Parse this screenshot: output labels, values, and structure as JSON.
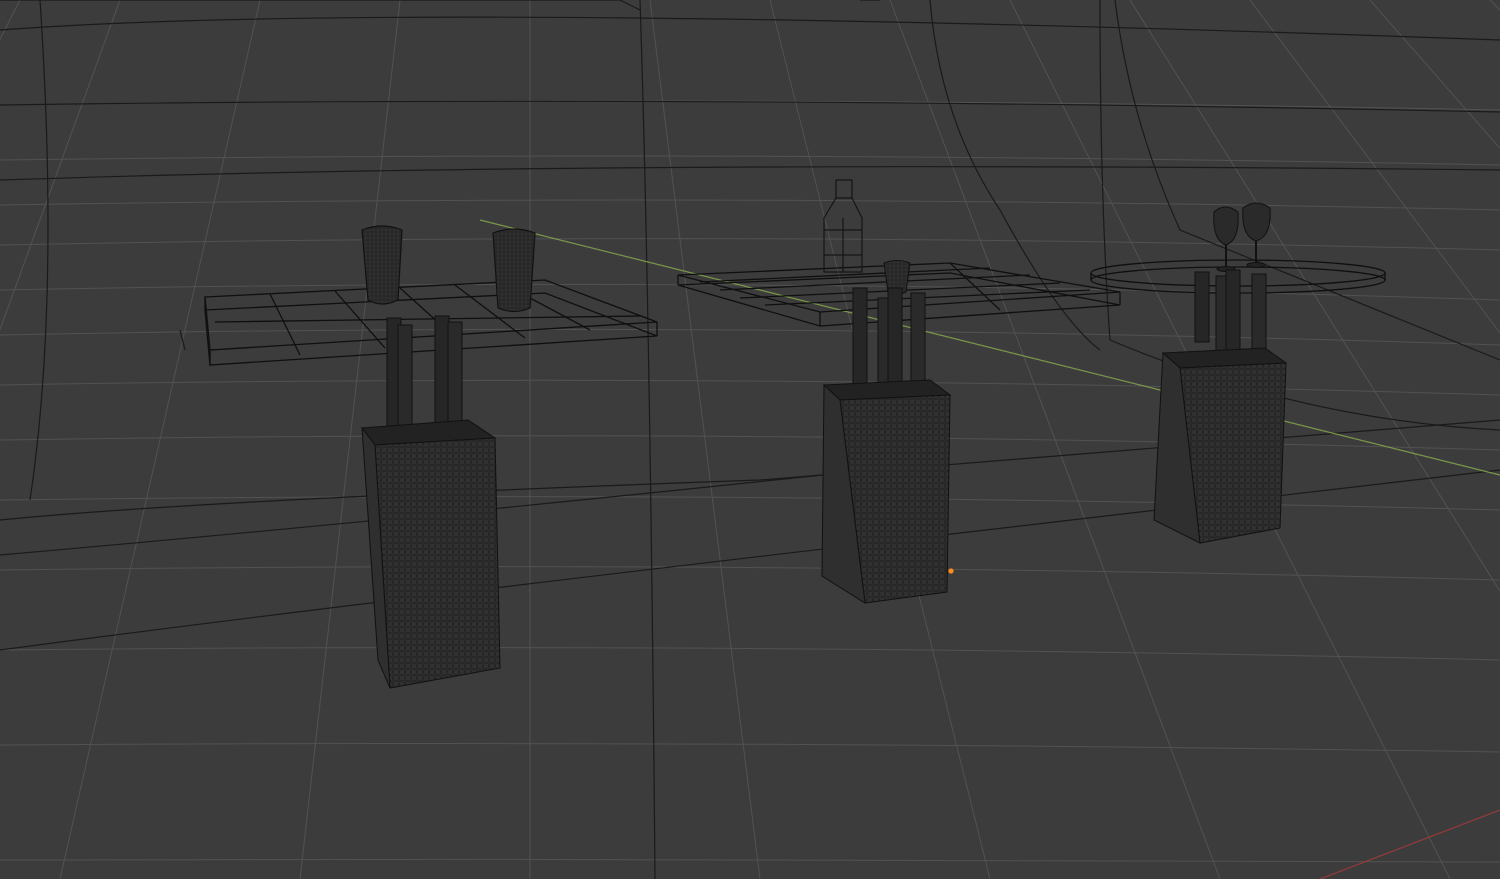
{
  "viewport": {
    "mode": "wireframe",
    "background_color": "#3c3c3c",
    "grid_color": "#525252",
    "wire_color": "#111111",
    "mesh_fill_color": "#2b2b2b",
    "x_axis_color": "#9a3a3a",
    "y_axis_color": "#7a9a4a",
    "origin_color": "#ff8c1a"
  },
  "scene": {
    "objects": [
      {
        "name": "shelf-left",
        "type": "wire-shelf"
      },
      {
        "name": "glass-left-1",
        "type": "tumbler-glass"
      },
      {
        "name": "glass-left-2",
        "type": "tumbler-glass"
      },
      {
        "name": "stand-left",
        "type": "pedestal-with-rods"
      },
      {
        "name": "shelf-middle",
        "type": "wire-shelf"
      },
      {
        "name": "bottle-middle",
        "type": "bottle"
      },
      {
        "name": "cup-middle",
        "type": "cup"
      },
      {
        "name": "stand-middle",
        "type": "pedestal-with-rods"
      },
      {
        "name": "tray-right",
        "type": "round-tray"
      },
      {
        "name": "wine-glass-right-1",
        "type": "wine-glass"
      },
      {
        "name": "wine-glass-right-2",
        "type": "wine-glass"
      },
      {
        "name": "stand-right",
        "type": "pedestal-with-rods"
      },
      {
        "name": "backdrop",
        "type": "curved-backdrop"
      }
    ]
  }
}
